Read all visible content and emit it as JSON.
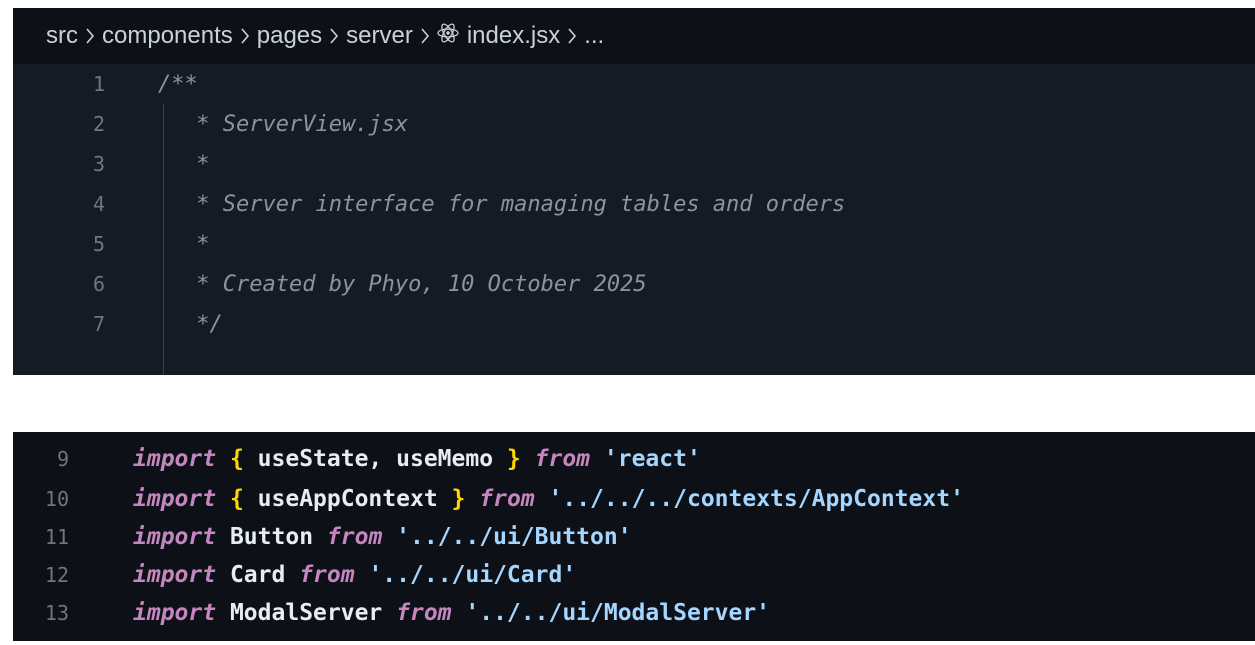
{
  "breadcrumb": {
    "items": [
      "src",
      "components",
      "pages",
      "server",
      "index.jsx",
      "..."
    ],
    "separator": ">",
    "file_icon": "react-icon"
  },
  "header_comment": {
    "lines": [
      {
        "number": "1",
        "text": "/**"
      },
      {
        "number": "2",
        "text": " * ServerView.jsx"
      },
      {
        "number": "3",
        "text": " *"
      },
      {
        "number": "4",
        "text": " * Server interface for managing tables and orders"
      },
      {
        "number": "5",
        "text": " *"
      },
      {
        "number": "6",
        "text": " * Created by Phyo, 10 October 2025"
      },
      {
        "number": "7",
        "text": " */"
      }
    ]
  },
  "imports": {
    "lines": [
      {
        "number": "9",
        "kw": "import",
        "open": "{",
        "names": " useState, useMemo ",
        "close": "}",
        "from": "from",
        "module": "'react'"
      },
      {
        "number": "10",
        "kw": "import",
        "open": "{",
        "names": " useAppContext ",
        "close": "}",
        "from": "from",
        "module": "'../../../contexts/AppContext'"
      },
      {
        "number": "11",
        "kw": "import",
        "default": "Button",
        "from": "from",
        "module": "'../../ui/Button'"
      },
      {
        "number": "12",
        "kw": "import",
        "default": "Card",
        "from": "from",
        "module": "'../../ui/Card'"
      },
      {
        "number": "13",
        "kw": "import",
        "default": "ModalServer",
        "from": "from",
        "module": "'../../ui/ModalServer'"
      }
    ]
  },
  "colors": {
    "editor_bg": "#0d1117",
    "comment": "#8b949e",
    "keyword": "#c586c0",
    "brace": "#ffd700",
    "string": "#a5d6ff",
    "line_number": "#6e7681"
  }
}
